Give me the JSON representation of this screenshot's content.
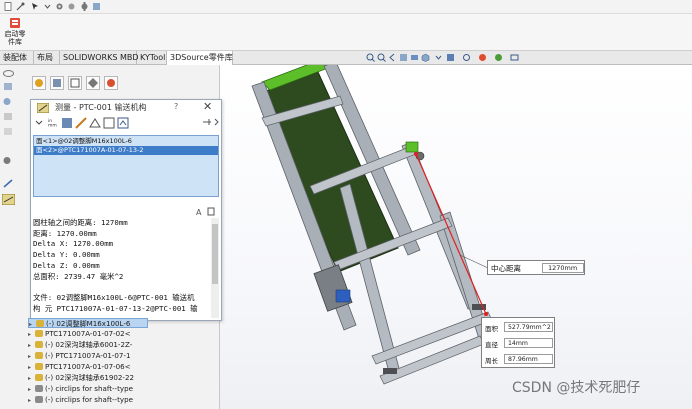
{
  "ribbon": {
    "startup_line1": "启动零",
    "startup_line2": "件库"
  },
  "tabs": [
    {
      "label": "装配体"
    },
    {
      "label": "布局"
    },
    {
      "label": "SOLIDWORKS MBD"
    },
    {
      "label": "KYTool"
    },
    {
      "label": "3DSource零件库"
    }
  ],
  "measure": {
    "title": "测量 - PTC-001 输送机构",
    "help": "?",
    "close": "✕",
    "toolbar_units": "in\nmm",
    "selections": [
      {
        "text": "面<1>@02调整脚M16x100L-6"
      },
      {
        "text": "面<2>@PTC171007A-01-07-13-2"
      }
    ],
    "results": [
      "圆柱轴之间的距离:  1270mm",
      "距离: 1270.00mm",
      "Delta X: 1270.00mm",
      "Delta Y: 0.00mm",
      "Delta Z: 0.00mm",
      "总面积: 2739.47 毫米^2",
      "",
      "文件:  02调整脚M16x100L-6@PTC-001 输送机",
      "构 元   PTC171007A-01-07-13-2@PTC-001 输"
    ]
  },
  "tree": [
    {
      "text": "(-) 02调整脚M16x100L-6",
      "selected": true,
      "color": "#d9b23a"
    },
    {
      "text": "PTC171007A-01-07-02<",
      "selected": false,
      "color": "#d9b23a"
    },
    {
      "text": "(-) 02深沟球轴承6001-2Z-",
      "selected": false,
      "color": "#d9b23a"
    },
    {
      "text": "(-) PTC171007A-01-07-1",
      "selected": false,
      "color": "#d9b23a"
    },
    {
      "text": "PTC171007A-01-07-06<",
      "selected": false,
      "color": "#d9b23a"
    },
    {
      "text": "(-) 02深沟球轴承61902-22",
      "selected": false,
      "color": "#d9b23a"
    },
    {
      "text": "(-) circlips for shaft--type",
      "selected": false,
      "color": "#8a8a8a"
    },
    {
      "text": "(-) circlips for shaft--type",
      "selected": false,
      "color": "#8a8a8a"
    }
  ],
  "callouts": {
    "distance_label": "中心距离",
    "distance_value": "1270mm",
    "area_label": "面积",
    "area_value": "527.79mm^2",
    "diameter_label": "直径",
    "diameter_value": "14mm",
    "perimeter_label": "周长",
    "perimeter_value": "87.96mm"
  },
  "watermark": "CSDN @技术死肥仔",
  "colors": {
    "selection_blue": "#3d7cc9",
    "list_bg": "#cfe3f6",
    "frame_gray": "#8e9399",
    "belt_green": "#2e4a1f",
    "roller_green": "#5cbf2a",
    "measure_line": "#e02020"
  }
}
